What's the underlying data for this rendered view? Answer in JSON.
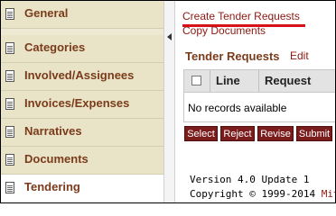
{
  "sidebar": {
    "items": [
      {
        "label": "General"
      },
      {
        "label": "Categories"
      },
      {
        "label": "Involved/Assignees"
      },
      {
        "label": "Invoices/Expenses"
      },
      {
        "label": "Narratives"
      },
      {
        "label": "Documents"
      },
      {
        "label": "Tendering"
      }
    ],
    "active_item": "Tendering"
  },
  "main": {
    "links": {
      "create_tender_requests": "Create Tender Requests",
      "copy_documents": "Copy Documents"
    },
    "section": {
      "title": "Tender Requests",
      "edit_label": "Edit"
    },
    "table": {
      "columns": [
        "Line",
        "Request"
      ],
      "empty_message": "No records available"
    },
    "buttons": {
      "select": "Select",
      "reject": "Reject",
      "revise": "Revise",
      "submit": "Submit"
    },
    "footer": {
      "version": "Version 4.0 Update 1",
      "copyright": "Copyright © 1999-2014",
      "company": "Mitra"
    }
  },
  "colors": {
    "sidebar_bg": "#e9e4c8",
    "link": "#8b1a12",
    "button_bg": "#7a1c1c",
    "annotation_underline": "#d8101a"
  }
}
